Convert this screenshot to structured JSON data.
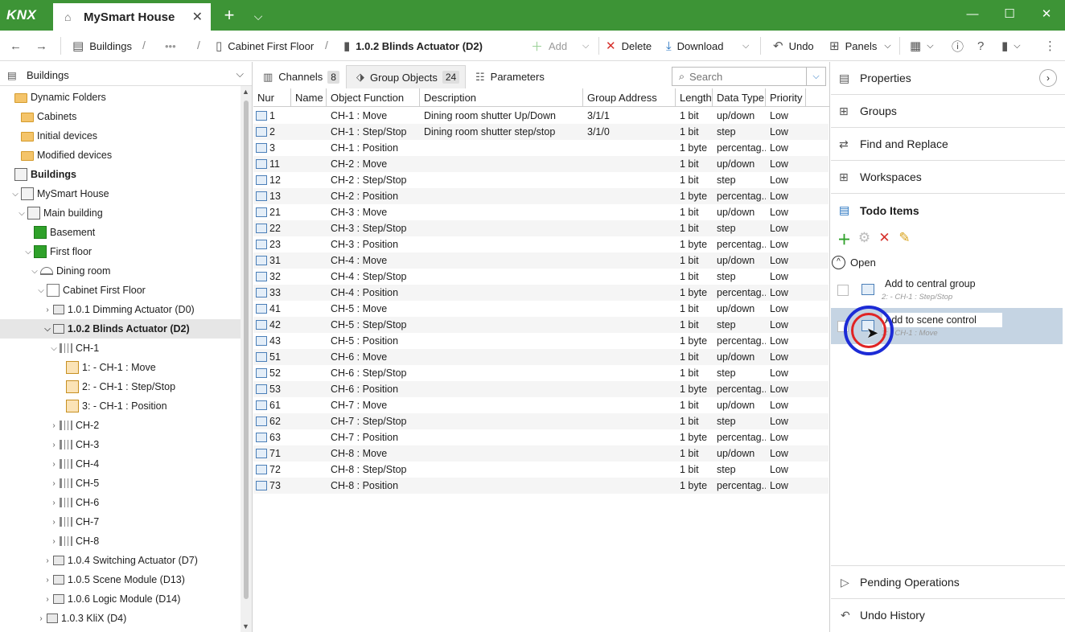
{
  "titlebar": {
    "logo": "KNX",
    "tab_title": "MySmart House",
    "new_tab": "+",
    "minimize": "—",
    "maximize": "☐",
    "close": "✕",
    "color": "#3d9436"
  },
  "toolbar": {
    "breadcrumb": [
      "Buildings",
      "•••",
      "Cabinet First Floor",
      "1.0.2 Blinds Actuator (D2)"
    ],
    "add": "Add",
    "delete": "Delete",
    "download": "Download",
    "undo": "Undo",
    "panels": "Panels"
  },
  "left": {
    "header": "Buildings",
    "tree": [
      {
        "label": "Dynamic Folders",
        "level": 0,
        "icon": "folder"
      },
      {
        "label": "Cabinets",
        "level": 1,
        "icon": "folder"
      },
      {
        "label": "Initial devices",
        "level": 1,
        "icon": "folder"
      },
      {
        "label": "Modified devices",
        "level": 1,
        "icon": "folder"
      },
      {
        "label": "Buildings",
        "level": 0,
        "icon": "bldg",
        "bold": true
      },
      {
        "label": "MySmart House",
        "level": 1,
        "icon": "bldg",
        "exp": "v"
      },
      {
        "label": "Main building",
        "level": 2,
        "icon": "bldg",
        "exp": "v"
      },
      {
        "label": "Basement",
        "level": 3,
        "icon": "grn"
      },
      {
        "label": "First floor",
        "level": 3,
        "icon": "grn",
        "exp": "v"
      },
      {
        "label": "Dining room",
        "level": 4,
        "icon": "room",
        "exp": "v"
      },
      {
        "label": "Cabinet First Floor",
        "level": 5,
        "icon": "cab",
        "exp": "v"
      },
      {
        "label": "1.0.1 Dimming Actuator (D0)",
        "level": 6,
        "icon": "device",
        "exp": ">"
      },
      {
        "label": "1.0.2 Blinds Actuator (D2)",
        "level": 6,
        "icon": "device",
        "exp": "v",
        "selected": true
      },
      {
        "label": "CH-1",
        "level": 7,
        "icon": "chan",
        "exp": "v"
      },
      {
        "label": "1:  - CH-1 : Move",
        "level": 8,
        "icon": "go"
      },
      {
        "label": "2:  - CH-1 : Step/Stop",
        "level": 8,
        "icon": "go"
      },
      {
        "label": "3:  - CH-1 : Position",
        "level": 8,
        "icon": "go"
      },
      {
        "label": "CH-2",
        "level": 7,
        "icon": "chan",
        "exp": ">"
      },
      {
        "label": "CH-3",
        "level": 7,
        "icon": "chan",
        "exp": ">"
      },
      {
        "label": "CH-4",
        "level": 7,
        "icon": "chan",
        "exp": ">"
      },
      {
        "label": "CH-5",
        "level": 7,
        "icon": "chan",
        "exp": ">"
      },
      {
        "label": "CH-6",
        "level": 7,
        "icon": "chan",
        "exp": ">"
      },
      {
        "label": "CH-7",
        "level": 7,
        "icon": "chan",
        "exp": ">"
      },
      {
        "label": "CH-8",
        "level": 7,
        "icon": "chan",
        "exp": ">"
      },
      {
        "label": "1.0.4 Switching Actuator (D7)",
        "level": 6,
        "icon": "device",
        "exp": ">"
      },
      {
        "label": "1.0.5 Scene Module (D13)",
        "level": 6,
        "icon": "device",
        "exp": ">"
      },
      {
        "label": "1.0.6 Logic Module (D14)",
        "level": 6,
        "icon": "device",
        "exp": ">"
      },
      {
        "label": "1.0.3 KliX (D4)",
        "level": 5,
        "icon": "device",
        "exp": ">"
      }
    ]
  },
  "center": {
    "tabs": [
      {
        "label": "Channels",
        "count": "8"
      },
      {
        "label": "Group Objects",
        "count": "24"
      },
      {
        "label": "Parameters",
        "count": ""
      }
    ],
    "search_placeholder": "Search",
    "columns": [
      "Nur",
      "Name",
      "Object Function",
      "Description",
      "Group Address",
      "Length",
      "Data Type",
      "Priority"
    ],
    "rows": [
      [
        "1",
        "",
        "CH-1 : Move",
        "Dining room shutter Up/Down",
        "3/1/1",
        "1 bit",
        "up/down",
        "Low"
      ],
      [
        "2",
        "",
        "CH-1 : Step/Stop",
        "Dining room shutter step/stop",
        "3/1/0",
        "1 bit",
        "step",
        "Low"
      ],
      [
        "3",
        "",
        "CH-1 : Position",
        "",
        "",
        "1 byte",
        "percentag...",
        "Low"
      ],
      [
        "11",
        "",
        "CH-2 : Move",
        "",
        "",
        "1 bit",
        "up/down",
        "Low"
      ],
      [
        "12",
        "",
        "CH-2 : Step/Stop",
        "",
        "",
        "1 bit",
        "step",
        "Low"
      ],
      [
        "13",
        "",
        "CH-2 : Position",
        "",
        "",
        "1 byte",
        "percentag...",
        "Low"
      ],
      [
        "21",
        "",
        "CH-3 : Move",
        "",
        "",
        "1 bit",
        "up/down",
        "Low"
      ],
      [
        "22",
        "",
        "CH-3 : Step/Stop",
        "",
        "",
        "1 bit",
        "step",
        "Low"
      ],
      [
        "23",
        "",
        "CH-3 : Position",
        "",
        "",
        "1 byte",
        "percentag...",
        "Low"
      ],
      [
        "31",
        "",
        "CH-4 : Move",
        "",
        "",
        "1 bit",
        "up/down",
        "Low"
      ],
      [
        "32",
        "",
        "CH-4 : Step/Stop",
        "",
        "",
        "1 bit",
        "step",
        "Low"
      ],
      [
        "33",
        "",
        "CH-4 : Position",
        "",
        "",
        "1 byte",
        "percentag...",
        "Low"
      ],
      [
        "41",
        "",
        "CH-5 : Move",
        "",
        "",
        "1 bit",
        "up/down",
        "Low"
      ],
      [
        "42",
        "",
        "CH-5 : Step/Stop",
        "",
        "",
        "1 bit",
        "step",
        "Low"
      ],
      [
        "43",
        "",
        "CH-5 : Position",
        "",
        "",
        "1 byte",
        "percentag...",
        "Low"
      ],
      [
        "51",
        "",
        "CH-6 : Move",
        "",
        "",
        "1 bit",
        "up/down",
        "Low"
      ],
      [
        "52",
        "",
        "CH-6 : Step/Stop",
        "",
        "",
        "1 bit",
        "step",
        "Low"
      ],
      [
        "53",
        "",
        "CH-6 : Position",
        "",
        "",
        "1 byte",
        "percentag...",
        "Low"
      ],
      [
        "61",
        "",
        "CH-7 : Move",
        "",
        "",
        "1 bit",
        "up/down",
        "Low"
      ],
      [
        "62",
        "",
        "CH-7 : Step/Stop",
        "",
        "",
        "1 bit",
        "step",
        "Low"
      ],
      [
        "63",
        "",
        "CH-7 : Position",
        "",
        "",
        "1 byte",
        "percentag...",
        "Low"
      ],
      [
        "71",
        "",
        "CH-8 : Move",
        "",
        "",
        "1 bit",
        "up/down",
        "Low"
      ],
      [
        "72",
        "",
        "CH-8 : Step/Stop",
        "",
        "",
        "1 bit",
        "step",
        "Low"
      ],
      [
        "73",
        "",
        "CH-8 : Position",
        "",
        "",
        "1 byte",
        "percentag...",
        "Low"
      ]
    ]
  },
  "right": {
    "sections": [
      "Properties",
      "Groups",
      "Find and Replace",
      "Workspaces",
      "Todo Items"
    ],
    "open_label": "Open",
    "todos": [
      {
        "title": "Add to central group",
        "sub": "2:  - CH-1 : Step/Stop"
      },
      {
        "title": "Add to scene control",
        "sub": "1:  - CH-1 : Move"
      }
    ],
    "pending": "Pending Operations",
    "undo_history": "Undo History"
  }
}
